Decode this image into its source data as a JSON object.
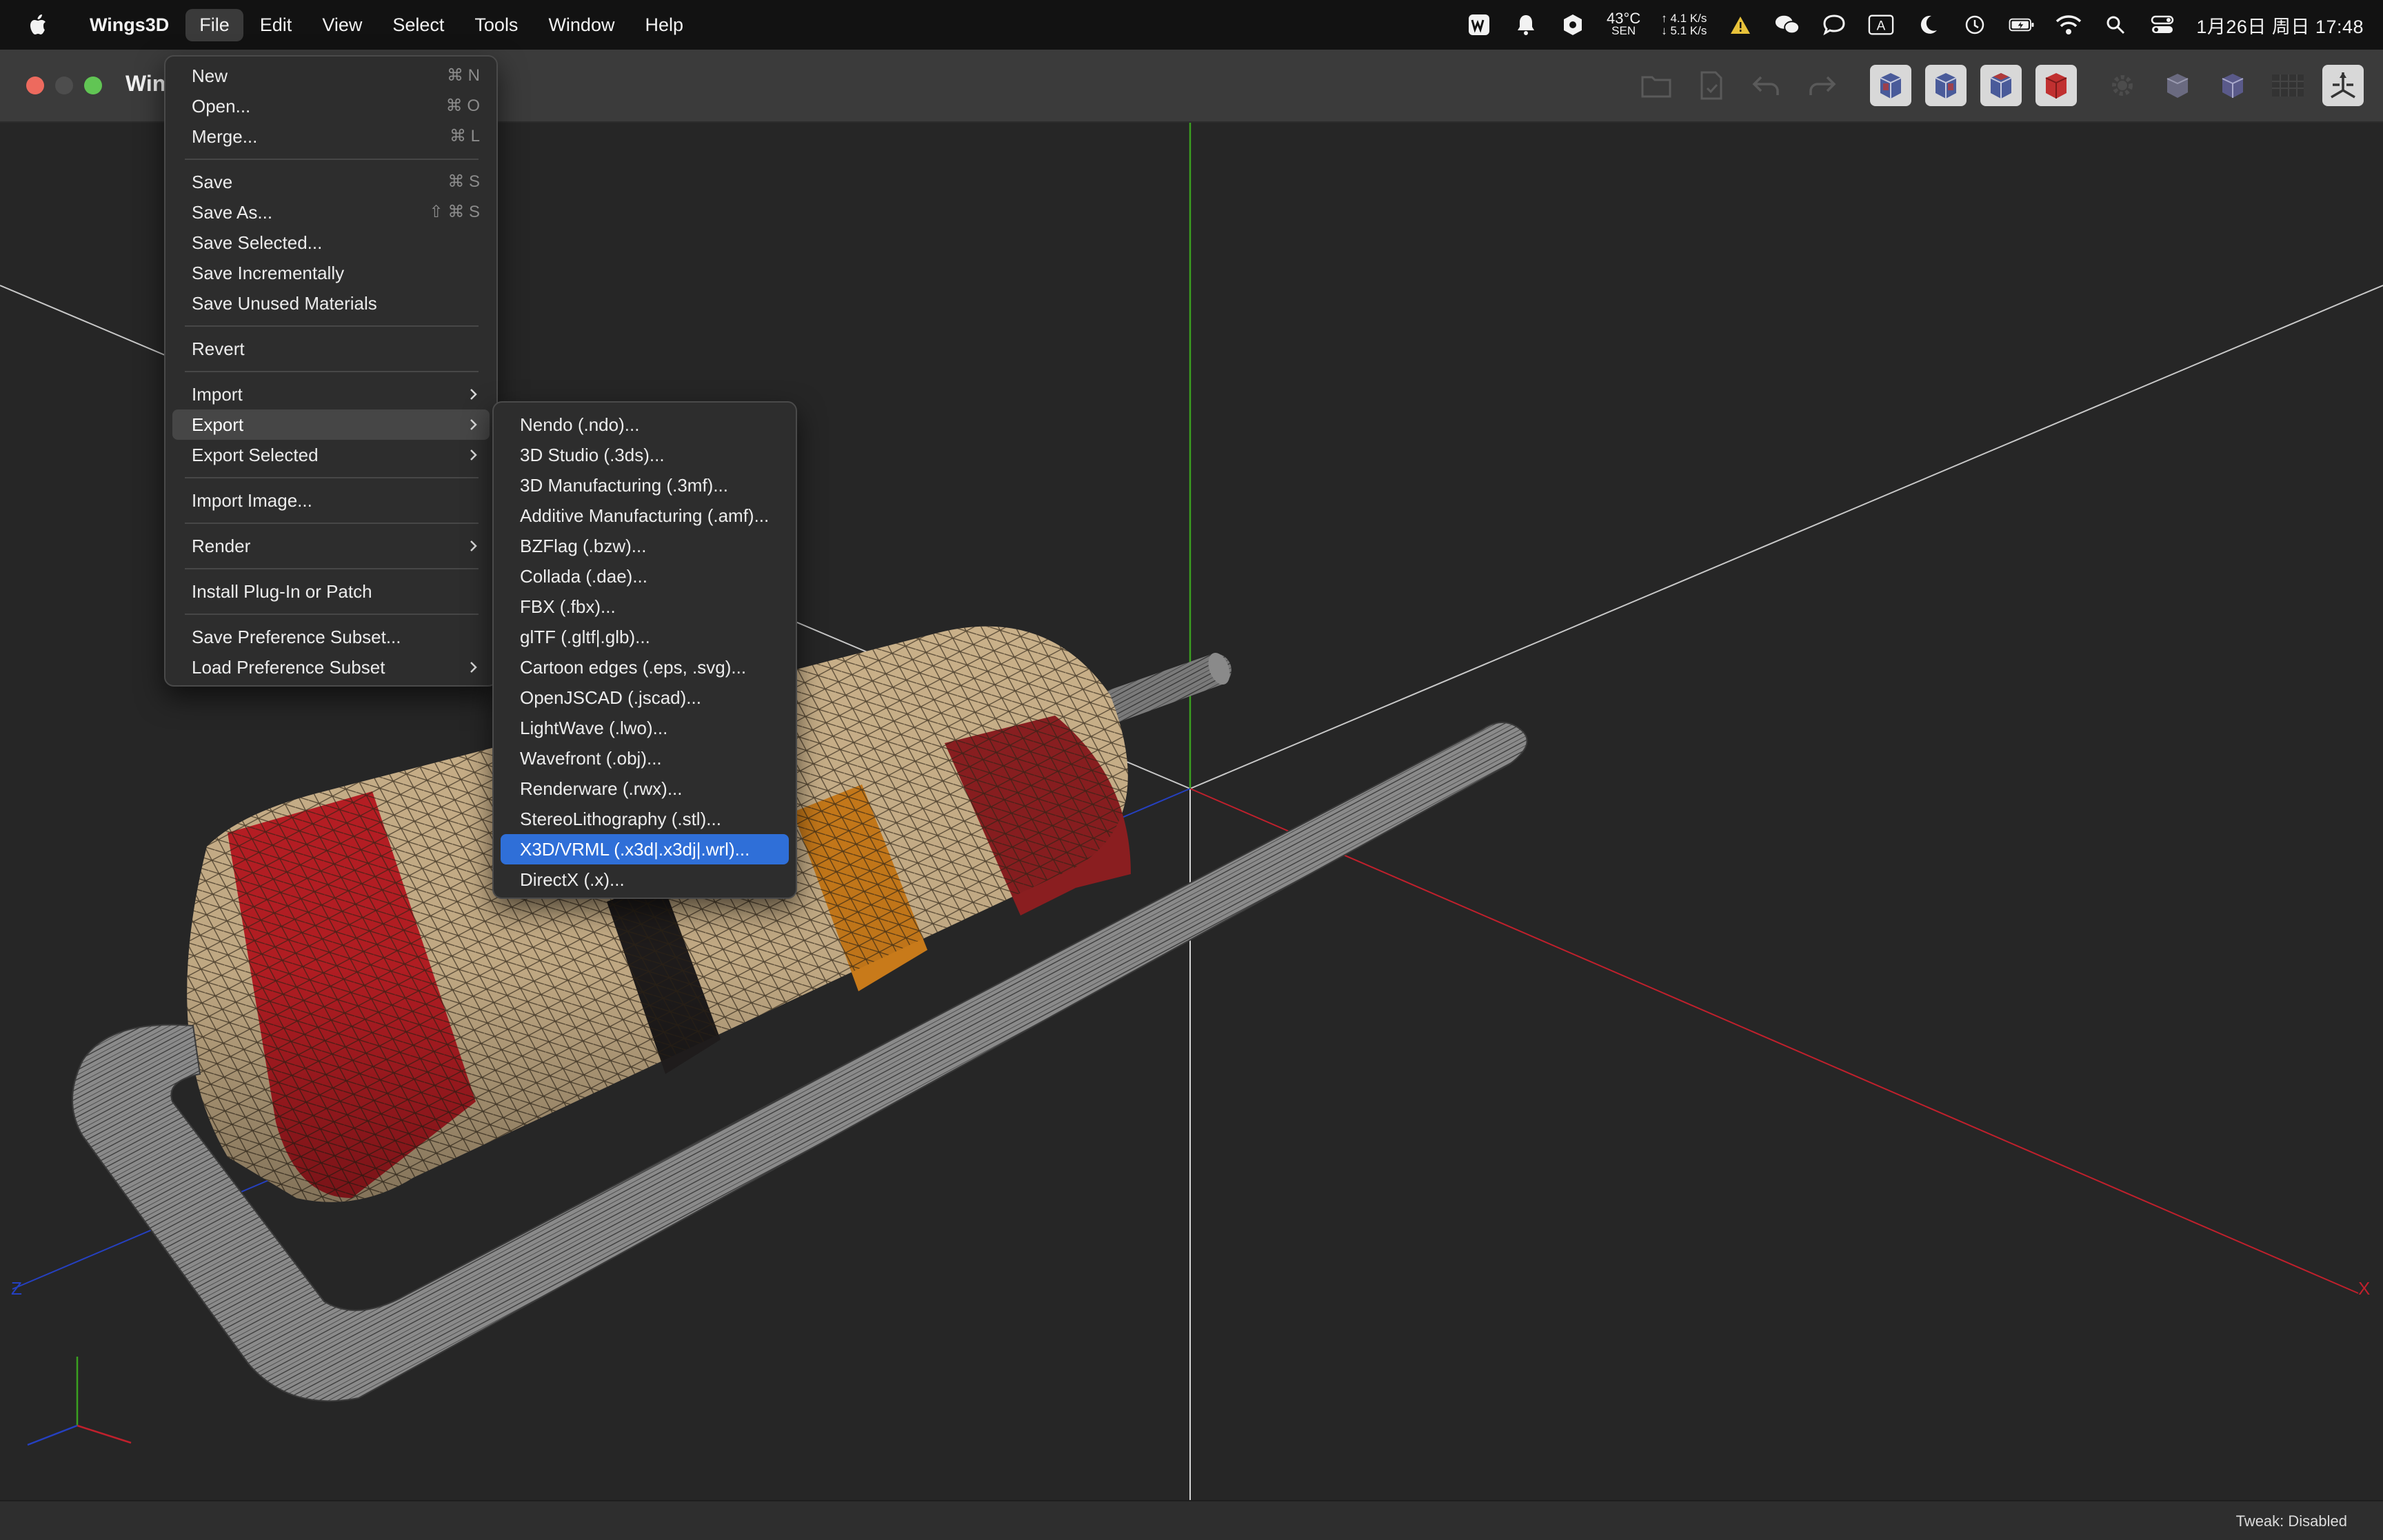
{
  "menubar": {
    "app_name": "Wings3D",
    "menus": [
      "File",
      "Edit",
      "View",
      "Select",
      "Tools",
      "Window",
      "Help"
    ],
    "active_menu": "File",
    "status": {
      "temp": "43°C",
      "temp_sub": "SEN",
      "net_up": "4.1",
      "net_down": "5.1",
      "net_unit": "K/s",
      "input_source": "A",
      "clock": "1月26日 周日  17:48"
    }
  },
  "window": {
    "title": "Win",
    "toolbar_icons": [
      "folder-open-icon",
      "save-file-icon",
      "undo-icon",
      "redo-icon",
      "view-front-cube-icon",
      "view-side-cube-icon",
      "view-perspective-cube-icon",
      "view-red-cube-icon",
      "settings-gear-icon",
      "smooth-cube-icon",
      "wire-cube-icon",
      "grid-icon",
      "axis-icon"
    ]
  },
  "file_menu": {
    "groups": [
      [
        {
          "label": "New",
          "shortcut": "⌘ N"
        },
        {
          "label": "Open...",
          "shortcut": "⌘ O"
        },
        {
          "label": "Merge...",
          "shortcut": "⌘ L"
        }
      ],
      [
        {
          "label": "Save",
          "shortcut": "⌘ S"
        },
        {
          "label": "Save As...",
          "shortcut": "⇧ ⌘ S"
        },
        {
          "label": "Save Selected..."
        },
        {
          "label": "Save Incrementally"
        },
        {
          "label": "Save Unused Materials"
        }
      ],
      [
        {
          "label": "Revert"
        }
      ],
      [
        {
          "label": "Import",
          "submenu": true
        },
        {
          "label": "Export",
          "submenu": true,
          "highlighted": true
        },
        {
          "label": "Export Selected",
          "submenu": true
        }
      ],
      [
        {
          "label": "Import Image..."
        }
      ],
      [
        {
          "label": "Render",
          "submenu": true
        }
      ],
      [
        {
          "label": "Install Plug-In or Patch"
        }
      ],
      [
        {
          "label": "Save Preference Subset..."
        },
        {
          "label": "Load Preference Subset",
          "submenu": true
        }
      ]
    ]
  },
  "export_menu": {
    "items": [
      "Nendo (.ndo)...",
      "3D Studio (.3ds)...",
      "3D Manufacturing (.3mf)...",
      "Additive Manufacturing (.amf)...",
      "BZFlag (.bzw)...",
      "Collada (.dae)...",
      "FBX (.fbx)...",
      "glTF (.gltf|.glb)...",
      "Cartoon edges (.eps, .svg)...",
      "OpenJSCAD (.jscad)...",
      "LightWave (.lwo)...",
      "Wavefront (.obj)...",
      "Renderware (.rwx)...",
      "StereoLithography (.stl)...",
      "X3D/VRML (.x3d|.x3dj|.wrl)...",
      "DirectX (.x)..."
    ],
    "highlighted_index": 14
  },
  "viewport": {
    "axis_labels": {
      "x": "X",
      "z": "Z"
    },
    "axis_colors": {
      "x": "#c0202c",
      "y": "#3aa020",
      "z": "#2540c0"
    }
  },
  "statusbar": {
    "tweak": "Tweak: Disabled"
  }
}
